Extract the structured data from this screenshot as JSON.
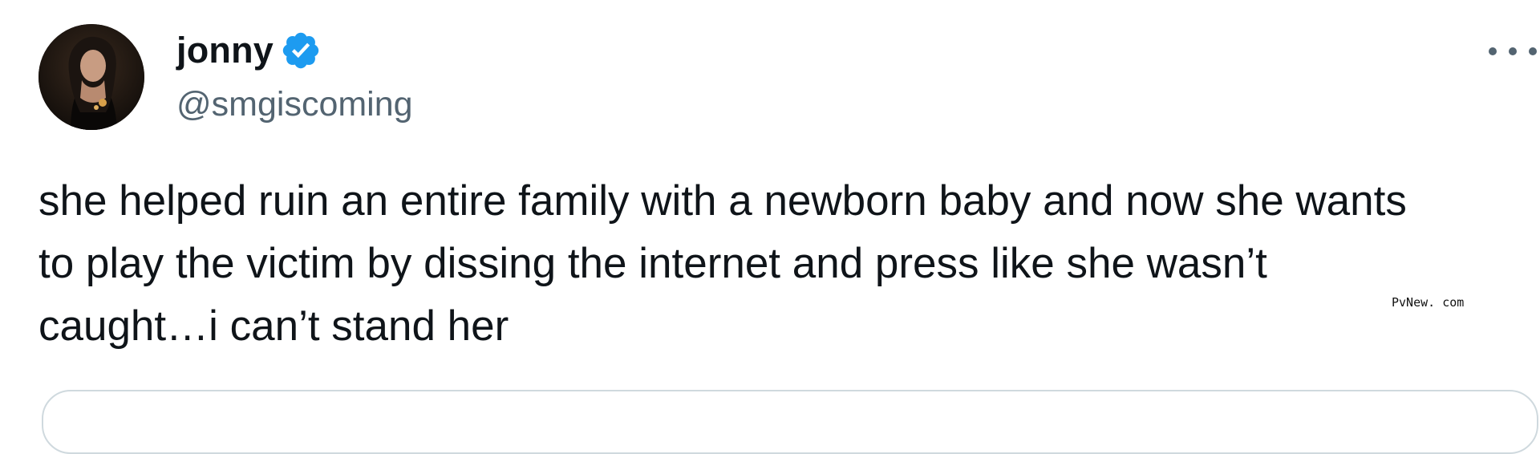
{
  "author": {
    "display_name": "jonny",
    "handle": "@smgiscoming",
    "avatar_icon": "profile-photo",
    "verified_icon": "verified-badge-icon",
    "verified_color": "#1d9bf0"
  },
  "more_options_icon": "more-horizontal-icon",
  "tweet": {
    "lines": [
      "she helped ruin an entire family with a newborn baby and now she wants",
      "to play the victim by dissing the internet and press like she wasn’t",
      "caught…i can’t stand her"
    ]
  },
  "watermark": "PvNew. com",
  "colors": {
    "text": "#0f1419",
    "secondary_text": "#536471",
    "border": "#cfd9de",
    "background": "#ffffff"
  }
}
